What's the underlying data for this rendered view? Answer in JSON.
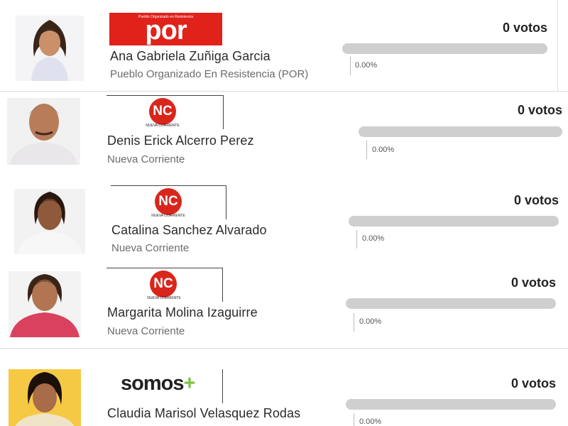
{
  "candidates": [
    {
      "name": "Ana Gabriela Zuñiga Garcia",
      "party": "Pueblo Organizado En Resistencia (POR)",
      "logo_text": "por",
      "logo_tagline": "Pueblo Organizado en Resistencia",
      "votes": "0 votos",
      "percent_label": "0.00%",
      "percent": 0
    },
    {
      "name": "Denis Erick Alcerro Perez",
      "party": "Nueva Corriente",
      "logo_text": "NC",
      "logo_tagline": "NUEVA CORRIENTE",
      "votes": "0 votos",
      "percent_label": "0.00%",
      "percent": 0
    },
    {
      "name": "Catalina Sanchez Alvarado",
      "party": "Nueva Corriente",
      "logo_text": "NC",
      "logo_tagline": "NUEVA CORRIENTE",
      "votes": "0 votos",
      "percent_label": "0.00%",
      "percent": 0
    },
    {
      "name": "Margarita Molina Izaguirre",
      "party": "Nueva Corriente",
      "logo_text": "NC",
      "logo_tagline": "NUEVA CORRIENTE",
      "votes": "0 votos",
      "percent_label": "0.00%",
      "percent": 0
    },
    {
      "name": "Claudia Marisol Velasquez Rodas",
      "party": "",
      "logo_text": "somos+",
      "votes": "0 votos",
      "percent_label": "0.00%",
      "percent": 0
    }
  ],
  "colors": {
    "por_red": "#e0221b",
    "nc_red": "#d9261c",
    "bar_track": "#cfcfcf",
    "somos_green": "#7cc243",
    "somos_red": "#e63a2e",
    "photo_bg_yellow": "#f6c945"
  }
}
